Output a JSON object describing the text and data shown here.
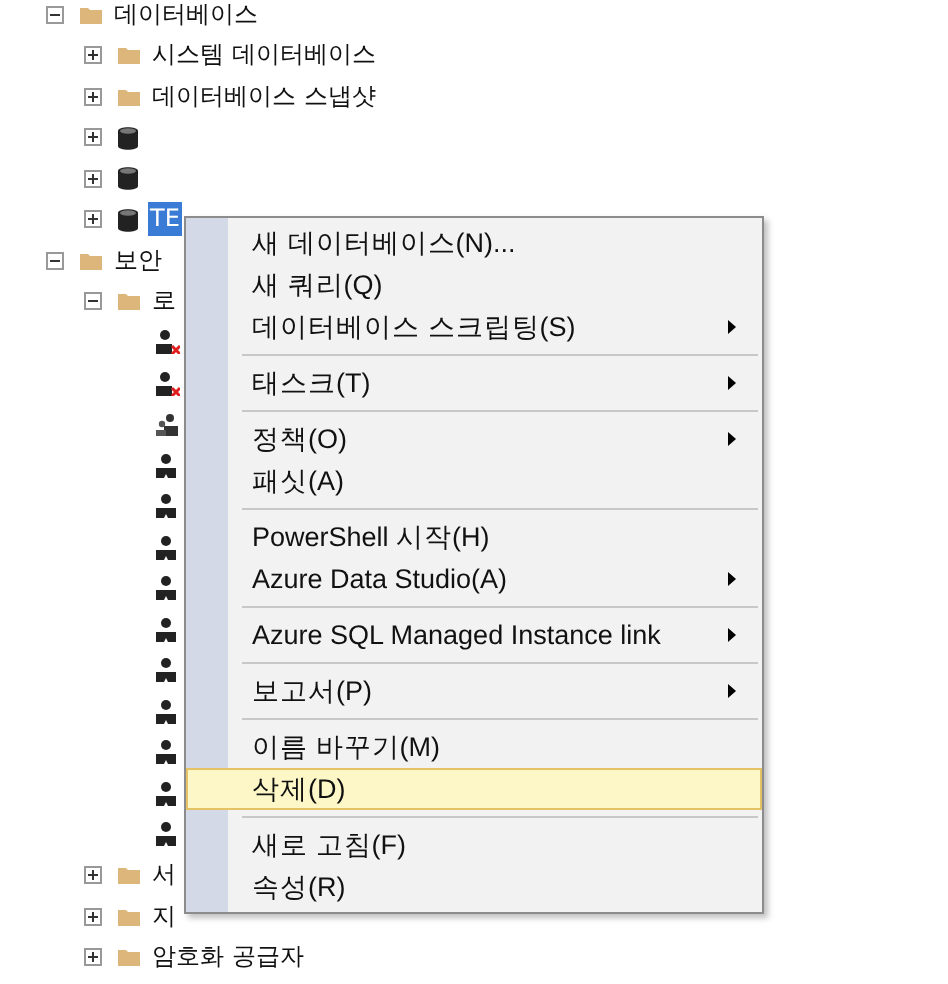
{
  "tree": [
    {
      "label": "데이터베이스",
      "kind": "folder",
      "expanded": true,
      "children": [
        {
          "label": "시스템 데이터베이스",
          "kind": "folder",
          "expanded": false
        },
        {
          "label": "데이터베이스 스냅샷",
          "kind": "folder",
          "expanded": false
        },
        {
          "kind": "database",
          "expanded": false
        },
        {
          "kind": "database",
          "expanded": false
        },
        {
          "label": "TE",
          "kind": "database",
          "expanded": false,
          "selected": true
        }
      ]
    },
    {
      "label": "보안",
      "kind": "folder",
      "expanded": true,
      "children": [
        {
          "label": "로",
          "kind": "folder",
          "expanded": true,
          "children": [
            {
              "kind": "user-disabled"
            },
            {
              "kind": "user-disabled"
            },
            {
              "kind": "group"
            },
            {
              "kind": "user"
            },
            {
              "kind": "user"
            },
            {
              "kind": "user"
            },
            {
              "kind": "user"
            },
            {
              "kind": "user"
            },
            {
              "kind": "user"
            },
            {
              "kind": "user"
            },
            {
              "kind": "user"
            },
            {
              "kind": "user"
            },
            {
              "kind": "user"
            }
          ]
        },
        {
          "label": "서",
          "kind": "folder",
          "expanded": false
        },
        {
          "label": "지",
          "kind": "folder",
          "expanded": false
        },
        {
          "label": "암호화 공급자",
          "kind": "folder",
          "expanded": false
        }
      ]
    }
  ],
  "context_menu": [
    {
      "kind": "item",
      "label": "새 데이터베이스(N)...",
      "submenu": false,
      "selected": false
    },
    {
      "kind": "item",
      "label": "새 쿼리(Q)",
      "submenu": false,
      "selected": false
    },
    {
      "kind": "item",
      "label": "데이터베이스 스크립팅(S)",
      "submenu": true,
      "selected": false
    },
    {
      "kind": "separator"
    },
    {
      "kind": "item",
      "label": "태스크(T)",
      "submenu": true,
      "selected": false
    },
    {
      "kind": "separator"
    },
    {
      "kind": "item",
      "label": "정책(O)",
      "submenu": true,
      "selected": false
    },
    {
      "kind": "item",
      "label": "패싯(A)",
      "submenu": false,
      "selected": false
    },
    {
      "kind": "separator"
    },
    {
      "kind": "item",
      "label": "PowerShell 시작(H)",
      "submenu": false,
      "selected": false
    },
    {
      "kind": "item",
      "label": "Azure Data Studio(A)",
      "submenu": true,
      "selected": false
    },
    {
      "kind": "separator"
    },
    {
      "kind": "item",
      "label": "Azure SQL Managed Instance link",
      "submenu": true,
      "selected": false
    },
    {
      "kind": "separator"
    },
    {
      "kind": "item",
      "label": "보고서(P)",
      "submenu": true,
      "selected": false
    },
    {
      "kind": "separator"
    },
    {
      "kind": "item",
      "label": "이름 바꾸기(M)",
      "submenu": false,
      "selected": false
    },
    {
      "kind": "item",
      "label": "삭제(D)",
      "submenu": false,
      "selected": true
    },
    {
      "kind": "separator"
    },
    {
      "kind": "item",
      "label": "새로 고침(F)",
      "submenu": false,
      "selected": false
    },
    {
      "kind": "item",
      "label": "속성(R)",
      "submenu": false,
      "selected": false
    }
  ]
}
